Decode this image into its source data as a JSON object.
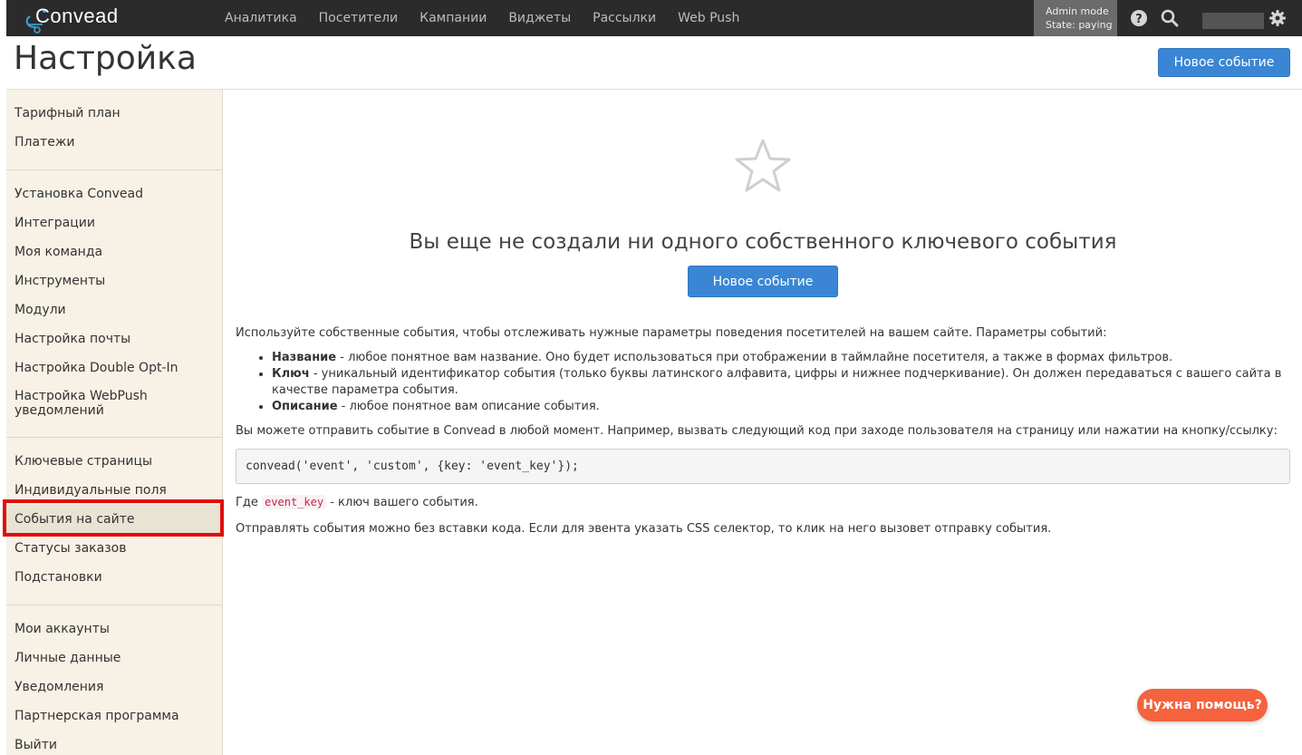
{
  "topbar": {
    "logo_text": "Convead",
    "nav": [
      "Аналитика",
      "Посетители",
      "Кампании",
      "Виджеты",
      "Рассылки",
      "Web Push"
    ],
    "admin_mode": "Admin mode",
    "admin_state": "State: paying",
    "icons": [
      "help-icon",
      "search-icon",
      "gear-icon"
    ]
  },
  "header": {
    "title": "Настройка",
    "new_event_button": "Новое событие"
  },
  "sidebar": {
    "groups": [
      [
        "Тарифный план",
        "Платежи"
      ],
      [
        "Установка Convead",
        "Интеграции",
        "Моя команда",
        "Инструменты",
        "Модули",
        "Настройка почты",
        "Настройка Double Opt-In",
        "Настройка WebPush уведомлений"
      ],
      [
        "Ключевые страницы",
        "Индивидуальные поля",
        "События на сайте",
        "Статусы заказов",
        "Подстановки"
      ],
      [
        "Мои аккаунты",
        "Личные данные",
        "Уведомления",
        "Партнерская программа",
        "Выйти"
      ]
    ],
    "active_item": "События на сайте"
  },
  "main": {
    "empty_title": "Вы еще не создали ни одного собственного ключевого события",
    "empty_button": "Новое событие",
    "intro": "Используйте собственные события, чтобы отслеживать нужные параметры поведения посетителей на вашем сайте. Параметры событий:",
    "params": [
      {
        "term": "Название",
        "text": " - любое понятное вам название. Оно будет использоваться при отображении в таймлайне посетителя, а также в формах фильтров."
      },
      {
        "term": "Ключ",
        "text": " - уникальный идентификатор события (только буквы латинского алфавита, цифры и нижнее подчеркивание). Он должен передаваться с вашего сайта в качестве параметра события."
      },
      {
        "term": "Описание",
        "text": " - любое понятное вам описание события."
      }
    ],
    "send_text": "Вы можете отправить событие в Convead в любой момент. Например, вызвать следующий код при заходе пользователя на страницу или нажатии на кнопку/ссылку:",
    "code": "convead('event', 'custom', {key: 'event_key'});",
    "where_prefix": "Где ",
    "where_code": "event_key",
    "where_suffix": " - ключ вашего события.",
    "selector_text": "Отправлять события можно без вставки кода. Если для эвента указать CSS селектор, то клик на него вызовет отправку события."
  },
  "help_button": "Нужна помощь?",
  "colors": {
    "topbar": "#2b2b2b",
    "primary": "#3a86d4",
    "sidebar_bg": "#f7f2e5",
    "highlight": "#e10c0c",
    "help": "#f4623e"
  }
}
